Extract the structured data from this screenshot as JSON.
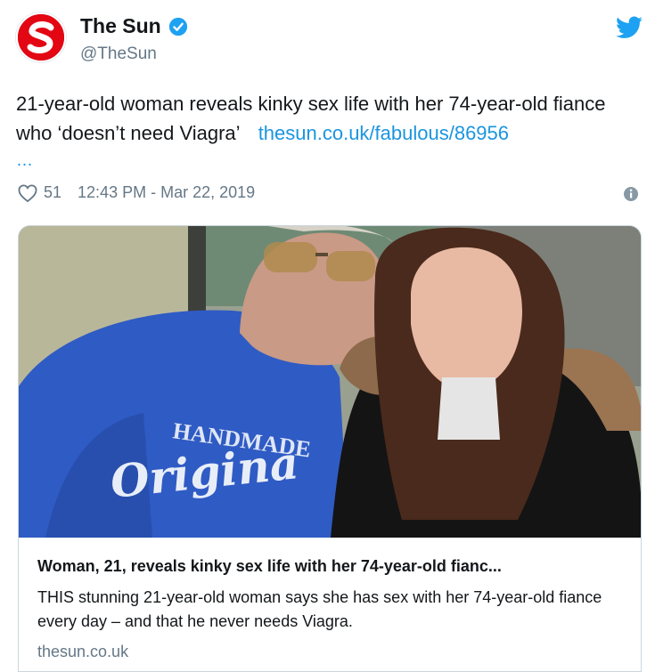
{
  "author": {
    "display_name": "The Sun",
    "handle": "@TheSun",
    "avatar_letter": "S",
    "verified": true
  },
  "tweet": {
    "text": "21-year-old woman reveals kinky sex life with her 74-year-old fiance who ‘doesn’t need Viagra’",
    "link_text": "thesun.co.uk/fabulous/86956",
    "truncation": "…"
  },
  "meta": {
    "like_count": "51",
    "timestamp": "12:43 PM - Mar 22, 2019"
  },
  "card": {
    "image_sweater_line1": "HANDMADE",
    "image_sweater_line2": "Origina",
    "title": "Woman, 21, reveals kinky sex life with her 74-year-old fianc...",
    "description": "THIS stunning 21-year-old woman says she has sex with her 74-year-old fiance every day – and that he never needs Viagra.",
    "domain": "thesun.co.uk"
  },
  "colors": {
    "brand_red": "#e30613",
    "twitter_blue": "#1da1f2",
    "link_blue": "#1b95e0",
    "muted_gray": "#657786"
  },
  "icons": [
    "twitter-bird-icon",
    "verified-badge-icon",
    "heart-icon",
    "info-icon"
  ]
}
